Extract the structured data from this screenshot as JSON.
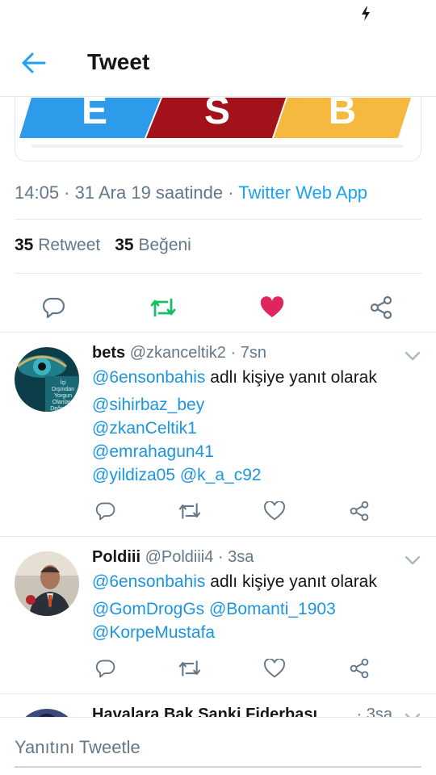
{
  "header": {
    "title": "Tweet"
  },
  "tweet": {
    "media_letters": [
      "E",
      "S",
      "B"
    ],
    "time": "14:05",
    "date": "31 Ara 19 saatinde",
    "source": "Twitter Web App",
    "retweet_count": "35",
    "retweet_label": "Retweet",
    "like_count": "35",
    "like_label": "Beğeni"
  },
  "colors": {
    "accent": "#1da1f2",
    "retweet": "#17bf63",
    "like": "#e0245e"
  },
  "replies": [
    {
      "name": "bets",
      "handle": "@zkanceltik2",
      "time": "7sn",
      "replying_to": "@6ensonbahis",
      "replying_suffix": "adlı kişiye yanıt olarak",
      "mentions": [
        "@sihirbaz_bey",
        "@zkanCeltik1",
        "@emrahagun41",
        "@yildiza05 @k_a_c92"
      ],
      "avatar_text": [
        "İçi",
        "Dışından",
        "Yorgun",
        "Olanlara",
        "Değmeyin"
      ]
    },
    {
      "name": "Poldiii",
      "handle": "@Poldiii4",
      "time": "3sa",
      "replying_to": "@6ensonbahis",
      "replying_suffix": "adlı kişiye yanıt olarak",
      "mentions": [
        "@GomDrogGs @Bomanti_1903",
        "@KorpeMustafa"
      ]
    },
    {
      "name": "Havalara Bak Sanki Fiderbası",
      "time": "3sa"
    }
  ],
  "compose": {
    "placeholder": "Yanıtını Tweetle"
  },
  "icons": [
    "back-arrow-icon",
    "reply-icon",
    "retweet-icon",
    "heart-icon",
    "share-icon",
    "chevron-down-icon",
    "bolt-icon"
  ]
}
